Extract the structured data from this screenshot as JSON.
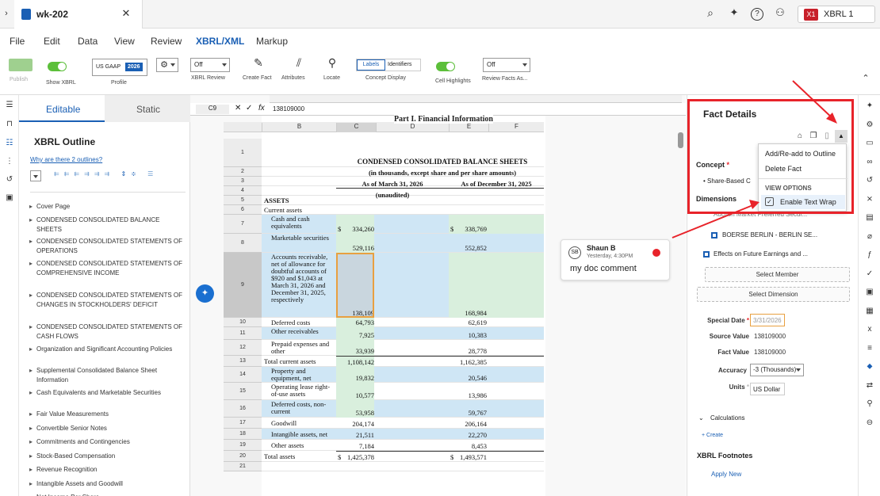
{
  "window": {
    "tab_title": "wk-202",
    "user_badge": "X1",
    "user_label": "XBRL 1"
  },
  "menu": {
    "items": [
      "File",
      "Edit",
      "Data",
      "View",
      "Review",
      "XBRL/XML",
      "Markup"
    ],
    "active": "XBRL/XML"
  },
  "toolbar": {
    "publish": "Publish",
    "show_xbrl": "Show XBRL",
    "profile_value": "US GAAP",
    "profile_year": "2026",
    "profile": "Profile",
    "xbrl_review_value": "Off",
    "xbrl_review": "XBRL Review",
    "create_fact": "Create Fact",
    "attributes": "Attributes",
    "locate": "Locate",
    "labels": "Labels",
    "identifiers": "Identifiers",
    "concept_display": "Concept Display",
    "cell_highlights": "Cell Highlights",
    "review_facts_value": "Off",
    "review_facts": "Review Facts As..."
  },
  "outline": {
    "tabs": [
      "Editable",
      "Static"
    ],
    "title": "XBRL Outline",
    "link": "Why are there 2 outlines?",
    "items": [
      "Cover Page",
      "CONDENSED CONSOLIDATED BALANCE SHEETS",
      "CONDENSED CONSOLIDATED STATEMENTS OF OPERATIONS",
      "CONDENSED CONSOLIDATED STATEMENTS OF COMPREHENSIVE INCOME",
      "CONDENSED CONSOLIDATED STATEMENTS OF CHANGES IN STOCKHOLDERS' DEFICIT",
      "CONDENSED CONSOLIDATED STATEMENTS OF CASH FLOWS",
      "Organization and Significant Accounting Policies",
      "Supplemental Consolidated Balance Sheet Information",
      "Cash Equivalents and Marketable Securities",
      "Fair Value Measurements",
      "Convertible Senior Notes",
      "Commitments and Contingencies",
      "Stock-Based Compensation",
      "Revenue Recognition",
      "Intangible Assets and Goodwill",
      "Net Income Per Share"
    ]
  },
  "sheet": {
    "cell_ref": "C9",
    "formula": "138109000",
    "columns": [
      "B",
      "C",
      "D",
      "E",
      "F"
    ],
    "part_title": "Part I. Financial Information",
    "title": "CONDENSED CONSOLIDATED BALANCE SHEETS",
    "subtitle": "(in thousands, except share and per share amounts)",
    "col_head_1": "As of March 31, 2026",
    "col_head_2": "As of December 31, 2025",
    "unaudited": "(unaudited)",
    "rows": [
      {
        "n": "1",
        "label": "",
        "c": "",
        "e": ""
      },
      {
        "n": "2",
        "label": "",
        "c": "",
        "e": ""
      },
      {
        "n": "3",
        "label": "",
        "c": "",
        "e": ""
      },
      {
        "n": "4",
        "label": "",
        "c": "",
        "e": ""
      },
      {
        "n": "5",
        "label": "ASSETS",
        "c": "",
        "e": ""
      },
      {
        "n": "6",
        "label": "Current assets",
        "c": "",
        "e": ""
      },
      {
        "n": "7",
        "label": "Cash and cash equivalents",
        "c": "334,260",
        "e": "338,769",
        "cs": "$",
        "es": "$"
      },
      {
        "n": "8",
        "label": "Marketable securities",
        "c": "529,116",
        "e": "552,852"
      },
      {
        "n": "9",
        "label": "Accounts receivable, net of allowance for doubtful accounts of $920 and $1,043 at March 31, 2026 and December 31, 2025, respectively",
        "c": "138,109",
        "e": "168,984"
      },
      {
        "n": "10",
        "label": "Deferred costs",
        "c": "64,793",
        "e": "62,619"
      },
      {
        "n": "11",
        "label": "Other receivables",
        "c": "7,925",
        "e": "10,383"
      },
      {
        "n": "12",
        "label": "Prepaid expenses and other",
        "c": "33,939",
        "e": "28,778"
      },
      {
        "n": "13",
        "label": "Total current assets",
        "c": "1,108,142",
        "e": "1,162,385"
      },
      {
        "n": "14",
        "label": "Property and equipment, net",
        "c": "19,832",
        "e": "20,546"
      },
      {
        "n": "15",
        "label": "Operating lease right-of-use assets",
        "c": "10,577",
        "e": "13,986"
      },
      {
        "n": "16",
        "label": "Deferred costs, non-current",
        "c": "53,958",
        "e": "59,767"
      },
      {
        "n": "17",
        "label": "Goodwill",
        "c": "204,174",
        "e": "206,164"
      },
      {
        "n": "18",
        "label": "Intangible assets, net",
        "c": "21,511",
        "e": "22,270"
      },
      {
        "n": "19",
        "label": "Other assets",
        "c": "7,184",
        "e": "8,453"
      },
      {
        "n": "20",
        "label": "Total assets",
        "c": "1,425,378",
        "e": "1,493,571",
        "cs": "$",
        "es": "$"
      },
      {
        "n": "21",
        "label": "",
        "c": "",
        "e": ""
      }
    ]
  },
  "comment": {
    "initials": "SB",
    "author": "Shaun B",
    "time": "Yesterday, 4:30PM",
    "text": "my doc comment"
  },
  "fact": {
    "title": "Fact Details",
    "concept": "Concept",
    "concept_value": "Share-Based C",
    "dimensions": "Dimensions",
    "dim_1": "Auction Market Preferred Secur...",
    "dim_2": "BOERSE BERLIN - BERLIN SE...",
    "dim_3": "Effects on Future Earnings and ...",
    "select_member": "Select Member",
    "select_dimension": "Select Dimension",
    "special_date_label": "Special Date",
    "special_date": "3/31/2026",
    "source_value_label": "Source Value",
    "source_value": "138109000",
    "fact_value_label": "Fact Value",
    "fact_value": "138109000",
    "accuracy_label": "Accuracy",
    "accuracy": "-3 (Thousands)",
    "units_label": "Units",
    "units": "US Dollar",
    "calculations": "Calculations",
    "create": "+ Create",
    "footnotes": "XBRL Footnotes",
    "apply_new": "Apply New",
    "menu": {
      "add": "Add/Re-add to Outline",
      "delete": "Delete Fact",
      "view_options": "VIEW OPTIONS",
      "wrap": "Enable Text Wrap"
    }
  },
  "colors": {
    "accent": "#1a5fb4",
    "highlight_blue": "#cfe6f5",
    "highlight_green": "#d9efdd",
    "red": "#e8232a",
    "toggle": "#5cbf3a"
  }
}
